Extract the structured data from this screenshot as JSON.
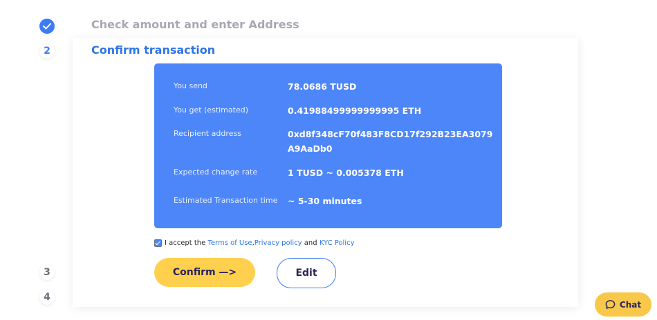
{
  "steps": {
    "step1": {
      "title": "Check amount and enter Address",
      "status": "done"
    },
    "step2": {
      "number": "2",
      "title": "Confirm transaction"
    },
    "step3": {
      "number": "3"
    },
    "step4": {
      "number": "4"
    }
  },
  "summary": {
    "rows": [
      {
        "label": "You send",
        "value": "78.0686 TUSD"
      },
      {
        "label": "You get (estimated)",
        "value": "0.41988499999999995 ETH"
      },
      {
        "label": "Recipient address",
        "value": "0xd8f348cF70f483F8CD17f292B23EA3079A9AaDb0"
      },
      {
        "label": "Expected change rate",
        "value": "1 TUSD ~ 0.005378 ETH"
      },
      {
        "label": "Estimated Transaction time",
        "value": "~ 5-30 minutes"
      }
    ]
  },
  "terms": {
    "checked": true,
    "prefix": "I accept the ",
    "terms_link": "Terms of Use",
    "comma": ", ",
    "privacy_link": "Privacy policy",
    "and": " and ",
    "kyc_link": "KYC Policy"
  },
  "buttons": {
    "confirm": "Confirm —>",
    "edit": "Edit"
  },
  "chat": {
    "label": "Chat",
    "icon": "chat-bubble-icon"
  },
  "colors": {
    "accent": "#3d7af6",
    "summary_bg": "#4d86f8",
    "confirm_bg": "#ffd04d",
    "chat_bg": "#f7c84a"
  }
}
